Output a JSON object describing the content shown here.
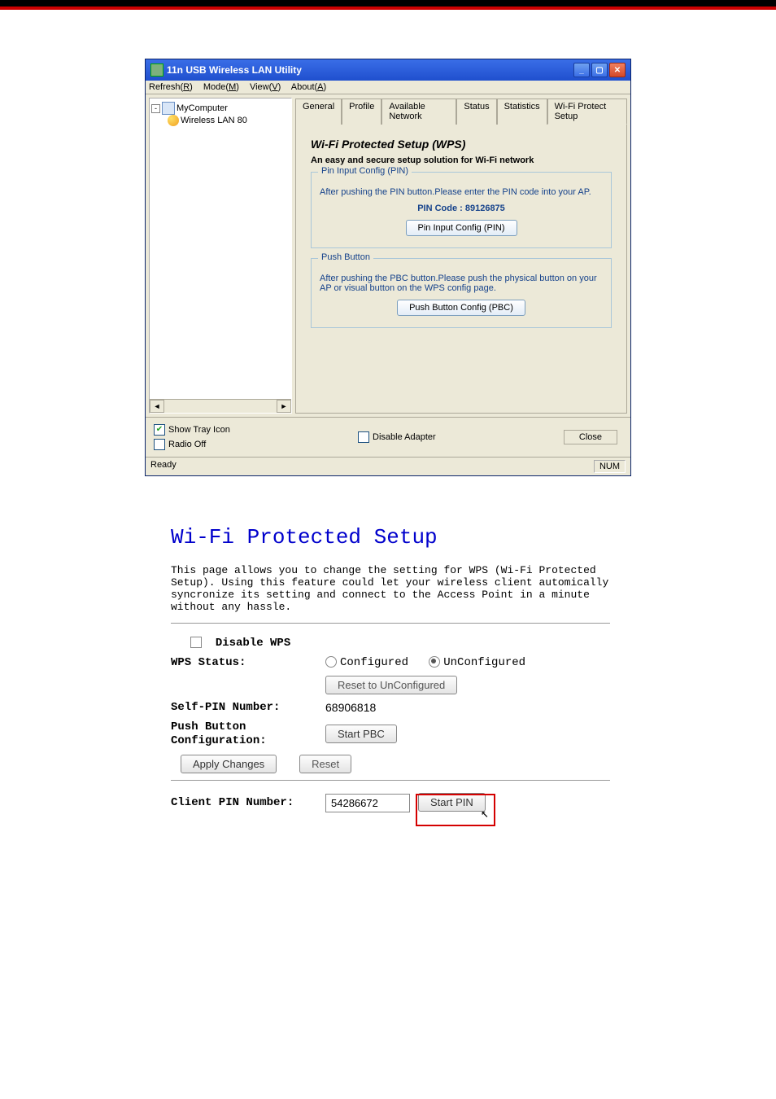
{
  "window": {
    "title": "11n USB Wireless LAN Utility",
    "menu": {
      "refresh": "Refresh(R)",
      "mode": "Mode(M)",
      "view": "View(V)",
      "about": "About(A)"
    },
    "tree": {
      "root": "MyComputer",
      "child": "Wireless LAN 80"
    },
    "tabs": {
      "general": "General",
      "profile": "Profile",
      "available": "Available Network",
      "status": "Status",
      "statistics": "Statistics",
      "wps": "Wi-Fi Protect Setup"
    },
    "wps": {
      "title": "Wi-Fi Protected Setup (WPS)",
      "subtitle": "An easy and secure setup solution for Wi-Fi network",
      "pin_group": {
        "legend": "Pin Input Config (PIN)",
        "desc": "After pushing the PIN button.Please enter the PIN code into your AP.",
        "code_label": "PIN Code :  89126875",
        "btn": "Pin Input Config (PIN)"
      },
      "pbc_group": {
        "legend": "Push Button",
        "desc": "After pushing the PBC button.Please push the physical button on your AP or visual button on the WPS config page.",
        "btn": "Push Button Config (PBC)"
      }
    },
    "bottom": {
      "show_tray": "Show Tray Icon",
      "radio_off": "Radio Off",
      "disable_adapter": "Disable Adapter",
      "close": "Close"
    },
    "status": {
      "ready": "Ready",
      "num": "NUM"
    }
  },
  "web": {
    "title": "Wi-Fi Protected Setup",
    "desc": "This page allows you to change the setting for WPS (Wi-Fi Protected Setup). Using this feature could let your wireless client automically syncronize its setting and connect to the Access Point in a minute without any hassle.",
    "disable_wps": "Disable WPS",
    "wps_status_label": "WPS Status:",
    "configured": "Configured",
    "unconfigured": "UnConfigured",
    "reset_unconf": "Reset to UnConfigured",
    "self_pin_label": "Self-PIN Number:",
    "self_pin_value": "68906818",
    "pbc_label": "Push Button Configuration:",
    "start_pbc": "Start PBC",
    "apply": "Apply Changes",
    "reset": "Reset",
    "client_pin_label": "Client PIN Number:",
    "client_pin_value": "54286672",
    "start_pin": "Start PIN"
  }
}
